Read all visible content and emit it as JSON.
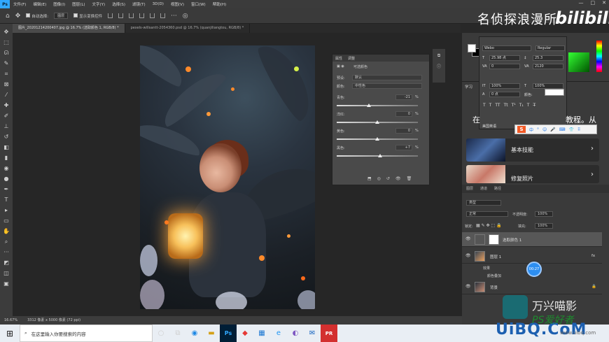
{
  "app": {
    "logo": "Ps",
    "brand_cn": "名侦探浪漫所",
    "bili": "bilibili"
  },
  "menu": [
    "文件(F)",
    "编辑(E)",
    "图像(I)",
    "图层(L)",
    "文字(Y)",
    "选择(S)",
    "滤镜(T)",
    "3D(D)",
    "视图(V)",
    "窗口(W)",
    "帮助(H)"
  ],
  "window_controls": [
    "—",
    "□",
    "✕"
  ],
  "options": {
    "auto_select_label": "自动选择:",
    "auto_select_value": "图层",
    "show_transform_label": "显示变换控件"
  },
  "tabs": [
    {
      "label": "图片_20201214200407.jpg @ 16.7% (选取颜色 1, RGB/8) *",
      "active": true
    },
    {
      "label": "pexels-willsantt-2054360.psd @ 16.7% (quanjiliangtou, RGB/8) *",
      "active": false
    }
  ],
  "props": {
    "tab1": "属性",
    "tab2": "调整",
    "title": "可选颜色",
    "preset_label": "预设:",
    "preset_value": "默认",
    "color_label": "颜色:",
    "color_value": "中性色",
    "sliders": [
      {
        "label": "青色:",
        "value": "-21",
        "level": -21
      },
      {
        "label": "洋红:",
        "value": "0",
        "level": 0
      },
      {
        "label": "黄色:",
        "value": "0",
        "level": 0
      },
      {
        "label": "黑色:",
        "value": "+7",
        "level": 7
      }
    ],
    "pct": "%"
  },
  "character": {
    "font": "Webo",
    "style": "Regular",
    "size": "25.98 点",
    "leading": "25.3",
    "kerning": "0",
    "tracking": "2120",
    "vscale": "100%",
    "hscale": "100%",
    "baseline": "0 点",
    "color_label": "颜色:",
    "lang": "美国英语",
    "aa": "aa",
    "styles": [
      "T",
      "T",
      "TT",
      "Tt",
      "T¹",
      "T₁",
      "T",
      "T̶"
    ]
  },
  "learn": {
    "tab": "学习",
    "title_left": "在",
    "title_right": "教程。从",
    "cards": [
      {
        "title": "基本技能",
        "arrow": "›"
      },
      {
        "title": "修复照片",
        "arrow": "›"
      }
    ]
  },
  "ime": {
    "badge": "S",
    "items": [
      "中",
      "°",
      "☺",
      "🎤",
      "⌨",
      "👕",
      "⠿"
    ]
  },
  "layers": {
    "tabs": [
      "图层",
      "通道",
      "路径"
    ],
    "filter_label": "类型",
    "blend_mode": "正常",
    "opacity_label": "不透明度:",
    "opacity": "100%",
    "lock_label": "锁定:",
    "fill_label": "填充:",
    "fill": "100%",
    "items": [
      {
        "name": "选取颜色 1",
        "selected": true
      },
      {
        "name": "图层 1",
        "selected": false,
        "fx": "fx"
      },
      {
        "name": "背景",
        "selected": false
      }
    ],
    "sub_effects": "效果",
    "sub_overlay": "颜色叠加",
    "cursor_label": "00:27"
  },
  "watermark": {
    "text": "万兴喵影"
  },
  "status": {
    "zoom": "16.67%",
    "doc": "3312 像素 x 5000 像素 (72 ppi)"
  },
  "taskbar": {
    "search_placeholder": "在这里输入你要搜索的内容",
    "apps": [
      "○",
      "⧉",
      "◉",
      "▬",
      "Ps",
      "◆",
      "▦",
      "e",
      "◐",
      "✉",
      "PR"
    ]
  },
  "site": {
    "logo": "UiBQ.CoM",
    "sub": "PS爱好者",
    "url": "www.uibq.com"
  }
}
